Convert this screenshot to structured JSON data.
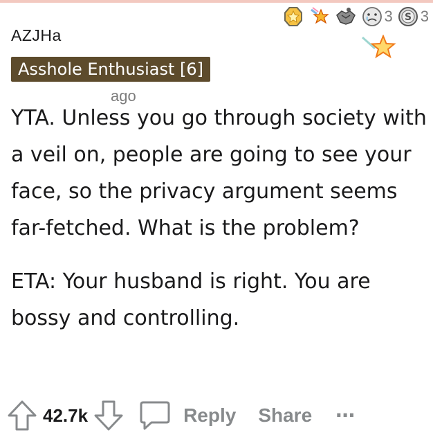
{
  "comment": {
    "username": "AZJHa",
    "flair": "Asshole Enthusiast [6]",
    "timestamp": "ago",
    "paragraphs": [
      "YTA. Unless you go through society with a veil on, people are going to see your face, so the privacy argument seems far-fetched. What is the problem?",
      "ETA: Your husband is right. You are bossy and controlling."
    ]
  },
  "awards": [
    {
      "icon": "gold-medal-icon"
    },
    {
      "icon": "rocket-star-icon"
    },
    {
      "icon": "handshake-icon"
    },
    {
      "icon": "crying-face-icon",
      "count": "3"
    },
    {
      "icon": "silver-coin-icon",
      "count": "3"
    },
    {
      "icon": "star-icon"
    }
  ],
  "actions": {
    "score": "42.7k",
    "reply_label": "Reply",
    "share_label": "Share",
    "more_label": "…"
  },
  "colors": {
    "flair_bg": "#5d4b2c",
    "action_gray": "#878a8c",
    "text": "#1a1a1b"
  }
}
